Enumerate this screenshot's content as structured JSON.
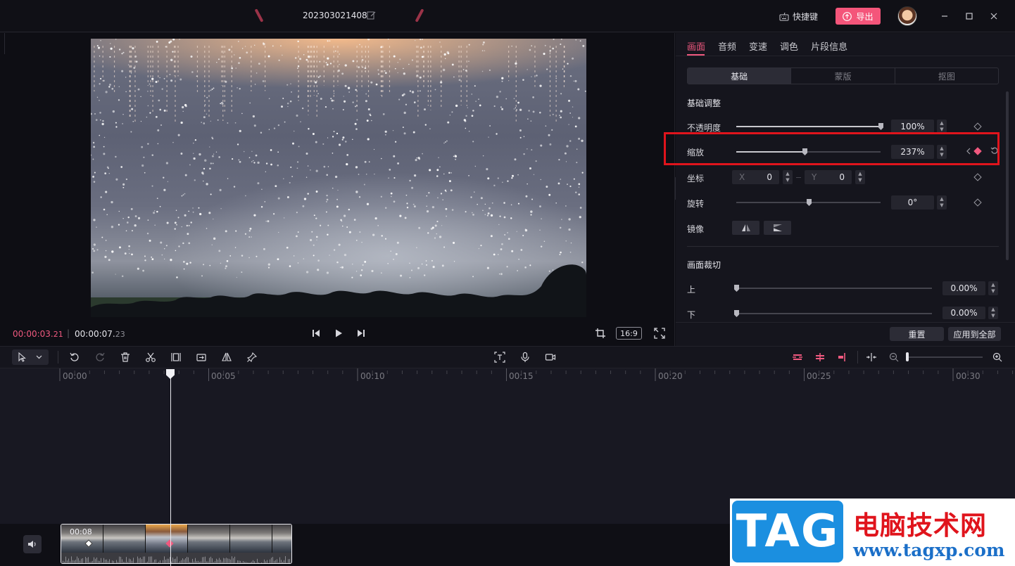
{
  "titlebar": {
    "project_name": "202303021408",
    "shortcut_label": "快捷键",
    "export_label": "导出"
  },
  "preview": {
    "current_time_main": "00:00:03.",
    "current_time_ms": "21",
    "total_time_main": "00:00:07.",
    "total_time_ms": "23",
    "aspect_ratio": "16:9"
  },
  "right_panel": {
    "tabs": [
      {
        "label": "画面",
        "active": true
      },
      {
        "label": "音频",
        "active": false
      },
      {
        "label": "变速",
        "active": false
      },
      {
        "label": "调色",
        "active": false
      },
      {
        "label": "片段信息",
        "active": false
      }
    ],
    "subtabs": [
      {
        "label": "基础",
        "active": true
      },
      {
        "label": "蒙版",
        "active": false
      },
      {
        "label": "抠图",
        "active": false
      }
    ],
    "basic_title": "基础调整",
    "opacity": {
      "label": "不透明度",
      "value": "100%",
      "level": 1.0
    },
    "scale": {
      "label": "缩放",
      "value": "237%",
      "level": 0.48
    },
    "position": {
      "label": "坐标",
      "x_label": "X",
      "x_value": "0",
      "y_label": "Y",
      "y_value": "0"
    },
    "rotation": {
      "label": "旋转",
      "value": "0°",
      "level": 0.5
    },
    "mirror": {
      "label": "镜像"
    },
    "crop_title": "画面裁切",
    "crop_top": {
      "label": "上",
      "value": "0.00%"
    },
    "crop_bottom": {
      "label": "下",
      "value": "0.00%"
    },
    "reset_label": "重置",
    "apply_all_label": "应用到全部"
  },
  "timeline": {
    "ruler_labels": [
      "00:00",
      "00:05",
      "00:10",
      "00:15",
      "00:20",
      "00:25",
      "00:30"
    ],
    "clip_duration": "00:08"
  },
  "watermark": {
    "logo_text": "TAG",
    "site_name": "电脑技术网",
    "url": "www.tagxp.com"
  },
  "colors": {
    "accent": "#f0597f",
    "highlight_box": "#e0141c",
    "panel_bg": "#15151d"
  }
}
